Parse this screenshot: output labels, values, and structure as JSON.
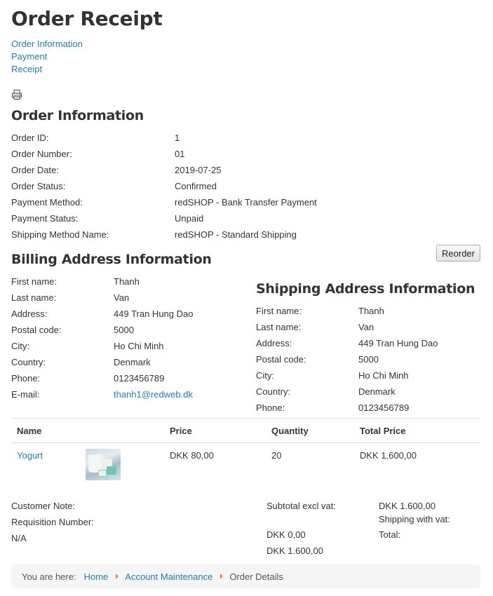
{
  "page": {
    "title": "Order Receipt"
  },
  "steps": [
    "Order Information",
    "Payment",
    "Receipt"
  ],
  "order_info": {
    "heading": "Order Information",
    "rows": [
      {
        "label": "Order ID:",
        "value": "1"
      },
      {
        "label": "Order Number:",
        "value": "01"
      },
      {
        "label": "Order Date:",
        "value": "2019-07-25"
      },
      {
        "label": "Order Status:",
        "value": "Confirmed"
      },
      {
        "label": "Payment Method:",
        "value": "redSHOP - Bank Transfer Payment"
      },
      {
        "label": "Payment Status:",
        "value": "Unpaid"
      },
      {
        "label": "Shipping Method Name:",
        "value": "redSHOP - Standard Shipping"
      }
    ]
  },
  "reorder_label": "Reorder",
  "billing": {
    "heading": "Billing Address Information",
    "rows": [
      {
        "label": "First name:",
        "value": "Thanh"
      },
      {
        "label": "Last name:",
        "value": "Van"
      },
      {
        "label": "Address:",
        "value": "449 Tran Hung Dao"
      },
      {
        "label": "Postal code:",
        "value": "5000"
      },
      {
        "label": "City:",
        "value": "Ho Chi Minh"
      },
      {
        "label": "Country:",
        "value": "Denmark"
      },
      {
        "label": "Phone:",
        "value": "0123456789"
      },
      {
        "label": "E-mail:",
        "value": "thanh1@redweb.dk"
      }
    ]
  },
  "shipping": {
    "heading": "Shipping Address Information",
    "rows": [
      {
        "label": "First name:",
        "value": "Thanh"
      },
      {
        "label": "Last name:",
        "value": "Van"
      },
      {
        "label": "Address:",
        "value": "449 Tran Hung Dao"
      },
      {
        "label": "Postal code:",
        "value": "5000"
      },
      {
        "label": "City:",
        "value": "Ho Chi Minh"
      },
      {
        "label": "Country:",
        "value": "Denmark"
      },
      {
        "label": "Phone:",
        "value": "0123456789"
      }
    ]
  },
  "items": {
    "columns": {
      "name": "Name",
      "price": "Price",
      "quantity": "Quantity",
      "total": "Total Price"
    },
    "rows": [
      {
        "name": "Yogurt",
        "price": "DKK 80,00",
        "quantity": "20",
        "total": "DKK 1.600,00",
        "image_icon": "yogurt-product-image"
      }
    ]
  },
  "notes": {
    "customer_note_label": "Customer Note:",
    "requisition_label": "Requisition Number:",
    "requisition_value": "N/A"
  },
  "totals": {
    "subtotal_label": "Subtotal excl vat:",
    "subtotal_value": "DKK 1.600,00",
    "shipping_label": "Shipping with vat:",
    "shipping_value": "DKK 0,00",
    "total_label": "Total:",
    "total_value": "DKK 1.600,00"
  },
  "breadcrumb": {
    "prefix": "You are here:",
    "items": [
      "Home",
      "Account Maintenance"
    ],
    "current": "Order Details"
  },
  "colors": {
    "link": "#1f7fb0",
    "breadcrumb_separator": "#e08a3c"
  },
  "icons": {
    "print": "print-icon",
    "breadcrumb_separator": "triangle-right-icon"
  }
}
